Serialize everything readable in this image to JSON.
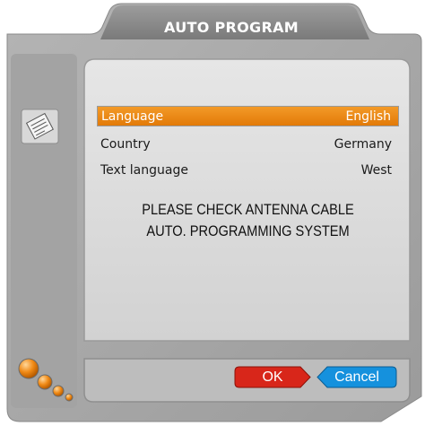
{
  "dialog": {
    "title": "AUTO PROGRAM"
  },
  "settings": [
    {
      "label": "Language",
      "value": "English",
      "selected": true
    },
    {
      "label": "Country",
      "value": "Germany",
      "selected": false
    },
    {
      "label": "Text language",
      "value": "West",
      "selected": false
    }
  ],
  "messages": {
    "line1": "PLEASE CHECK ANTENNA CABLE",
    "line2": "AUTO. PROGRAMMING SYSTEM"
  },
  "buttons": {
    "ok_label": "OK",
    "cancel_label": "Cancel"
  },
  "icons": {
    "menu": "checklist-document-icon",
    "decoration": "orange-bubbles-icon"
  },
  "colors": {
    "frame_gray": "#a8a8a8",
    "panel_gray": "#d9d9d9",
    "highlight_orange": "#e9850f",
    "ok_red": "#d8261a",
    "cancel_blue": "#1591dd"
  }
}
